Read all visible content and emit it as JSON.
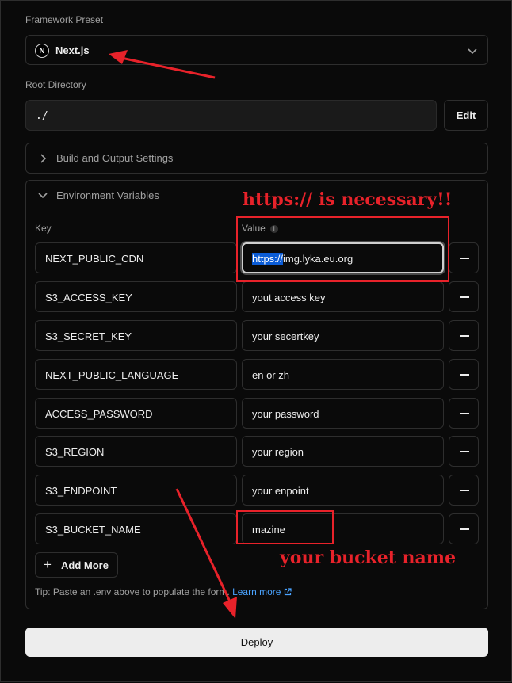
{
  "framework_preset": {
    "label": "Framework Preset",
    "value": "Next.js",
    "logo_glyph": "N"
  },
  "root_directory": {
    "label": "Root Directory",
    "value": "./",
    "edit_label": "Edit"
  },
  "build_output": {
    "label": "Build and Output Settings"
  },
  "env": {
    "title": "Environment Variables",
    "key_header": "Key",
    "value_header": "Value",
    "info_glyph": "i",
    "rows": [
      {
        "key": "NEXT_PUBLIC_CDN",
        "value_selected": "https://",
        "value_rest": "img.lyka.eu.org"
      },
      {
        "key": "S3_ACCESS_KEY",
        "value": "yout access key"
      },
      {
        "key": "S3_SECRET_KEY",
        "value": "your secertkey"
      },
      {
        "key": "NEXT_PUBLIC_LANGUAGE",
        "value": "en or zh"
      },
      {
        "key": "ACCESS_PASSWORD",
        "value": "your password"
      },
      {
        "key": "S3_REGION",
        "value": "your region"
      },
      {
        "key": "S3_ENDPOINT",
        "value": "your enpoint"
      },
      {
        "key": "S3_BUCKET_NAME",
        "value": "mazine"
      }
    ],
    "add_more_label": "Add More",
    "tip_text": "Tip: Paste an .env above to populate the form.",
    "learn_more_label": "Learn more"
  },
  "deploy_label": "Deploy",
  "annotations": {
    "https_note": "https://  is necessary!!",
    "bucket_note": "your bucket name",
    "color": "#e8222a"
  }
}
